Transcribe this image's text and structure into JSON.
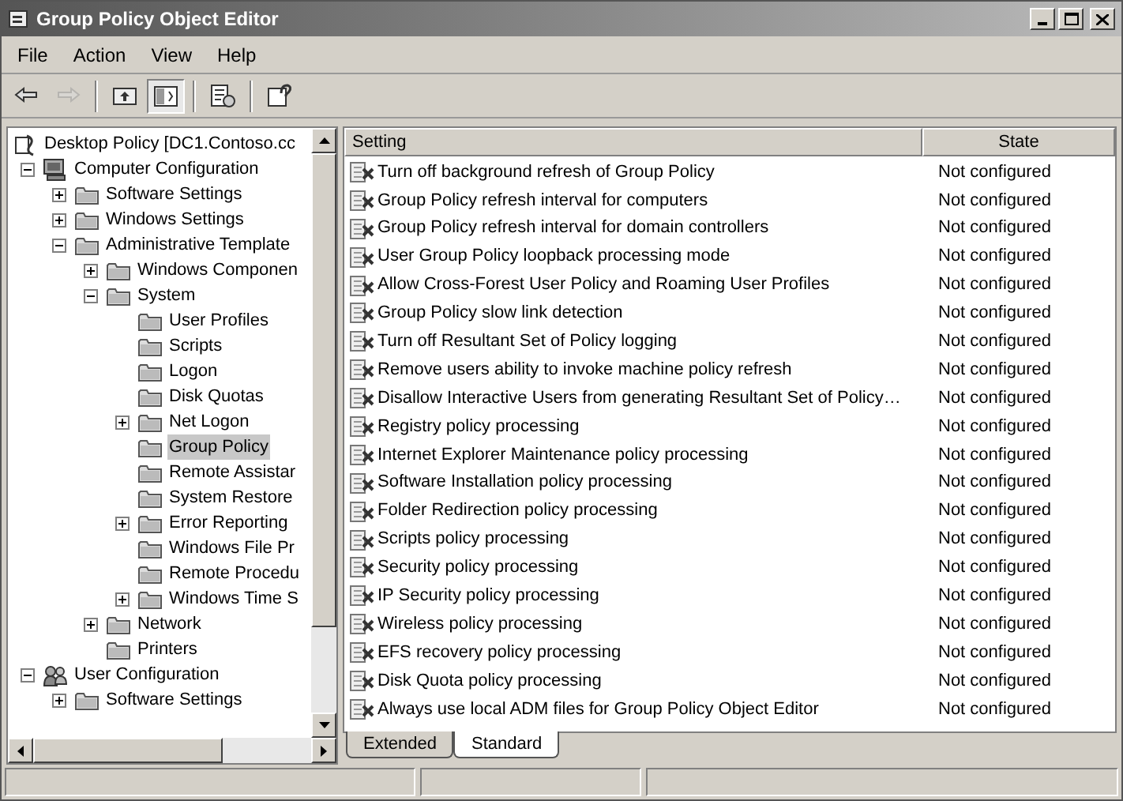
{
  "window": {
    "title": "Group Policy Object Editor"
  },
  "menu": [
    "File",
    "Action",
    "View",
    "Help"
  ],
  "toolbar": [
    {
      "kind": "back",
      "disabled": false,
      "pressed": false
    },
    {
      "kind": "forward",
      "disabled": true,
      "pressed": false
    },
    {
      "kind": "up",
      "disabled": false,
      "pressed": false
    },
    {
      "kind": "tree",
      "disabled": false,
      "pressed": true
    },
    {
      "kind": "export",
      "disabled": false,
      "pressed": false
    },
    {
      "kind": "help",
      "disabled": false,
      "pressed": false
    }
  ],
  "tree": [
    {
      "label": "Desktop Policy [DC1.Contoso.cc",
      "kind": "policy",
      "selected": false,
      "children": [
        {
          "label": "Computer Configuration",
          "kind": "computer",
          "expanded": true,
          "selected": false,
          "children": [
            {
              "label": "Software Settings",
              "kind": "folder",
              "expanded": false,
              "selected": false
            },
            {
              "label": "Windows Settings",
              "kind": "folder",
              "expanded": false,
              "selected": false
            },
            {
              "label": "Administrative Template",
              "kind": "folder",
              "expanded": true,
              "selected": false,
              "children": [
                {
                  "label": "Windows Componen",
                  "kind": "folder",
                  "expanded": false,
                  "selected": false
                },
                {
                  "label": "System",
                  "kind": "folder",
                  "expanded": true,
                  "selected": false,
                  "children": [
                    {
                      "label": "User Profiles",
                      "kind": "folder",
                      "selected": false
                    },
                    {
                      "label": "Scripts",
                      "kind": "folder",
                      "selected": false
                    },
                    {
                      "label": "Logon",
                      "kind": "folder",
                      "selected": false
                    },
                    {
                      "label": "Disk Quotas",
                      "kind": "folder",
                      "selected": false
                    },
                    {
                      "label": "Net Logon",
                      "kind": "folder",
                      "expanded": false,
                      "selected": false
                    },
                    {
                      "label": "Group Policy",
                      "kind": "folder",
                      "selected": true
                    },
                    {
                      "label": "Remote Assistar",
                      "kind": "folder",
                      "selected": false
                    },
                    {
                      "label": "System Restore",
                      "kind": "folder",
                      "selected": false
                    },
                    {
                      "label": "Error Reporting",
                      "kind": "folder",
                      "expanded": false,
                      "selected": false
                    },
                    {
                      "label": "Windows File Pr",
                      "kind": "folder",
                      "selected": false
                    },
                    {
                      "label": "Remote Procedu",
                      "kind": "folder",
                      "selected": false
                    },
                    {
                      "label": "Windows Time S",
                      "kind": "folder",
                      "expanded": false,
                      "selected": false
                    }
                  ]
                },
                {
                  "label": "Network",
                  "kind": "folder",
                  "expanded": false,
                  "selected": false
                },
                {
                  "label": "Printers",
                  "kind": "folder",
                  "selected": false
                }
              ]
            }
          ]
        },
        {
          "label": "User Configuration",
          "kind": "user",
          "expanded": true,
          "selected": false,
          "children": [
            {
              "label": "Software Settings",
              "kind": "folder",
              "expanded": false,
              "selected": false
            }
          ]
        }
      ]
    }
  ],
  "table": {
    "columns": [
      "Setting",
      "State"
    ],
    "rows": [
      [
        "Turn off background refresh of Group Policy",
        "Not configured"
      ],
      [
        "Group Policy refresh interval for computers",
        "Not configured"
      ],
      [
        "Group Policy refresh interval for domain controllers",
        "Not configured"
      ],
      [
        "User Group Policy loopback processing mode",
        "Not configured"
      ],
      [
        "Allow Cross-Forest User Policy and Roaming User Profiles",
        "Not configured"
      ],
      [
        "Group Policy slow link detection",
        "Not configured"
      ],
      [
        "Turn off Resultant Set of Policy logging",
        "Not configured"
      ],
      [
        "Remove users ability to invoke machine policy refresh",
        "Not configured"
      ],
      [
        "Disallow Interactive Users from generating Resultant Set of Policy…",
        "Not configured"
      ],
      [
        "Registry policy processing",
        "Not configured"
      ],
      [
        "Internet Explorer Maintenance policy processing",
        "Not configured"
      ],
      [
        "Software Installation policy processing",
        "Not configured"
      ],
      [
        "Folder Redirection policy processing",
        "Not configured"
      ],
      [
        "Scripts policy processing",
        "Not configured"
      ],
      [
        "Security policy processing",
        "Not configured"
      ],
      [
        "IP Security policy processing",
        "Not configured"
      ],
      [
        "Wireless policy processing",
        "Not configured"
      ],
      [
        "EFS recovery policy processing",
        "Not configured"
      ],
      [
        "Disk Quota policy processing",
        "Not configured"
      ],
      [
        "Always use local ADM files for Group Policy Object Editor",
        "Not configured"
      ]
    ]
  },
  "tabs": [
    {
      "label": "Extended",
      "selected": false
    },
    {
      "label": "Standard",
      "selected": true
    }
  ]
}
